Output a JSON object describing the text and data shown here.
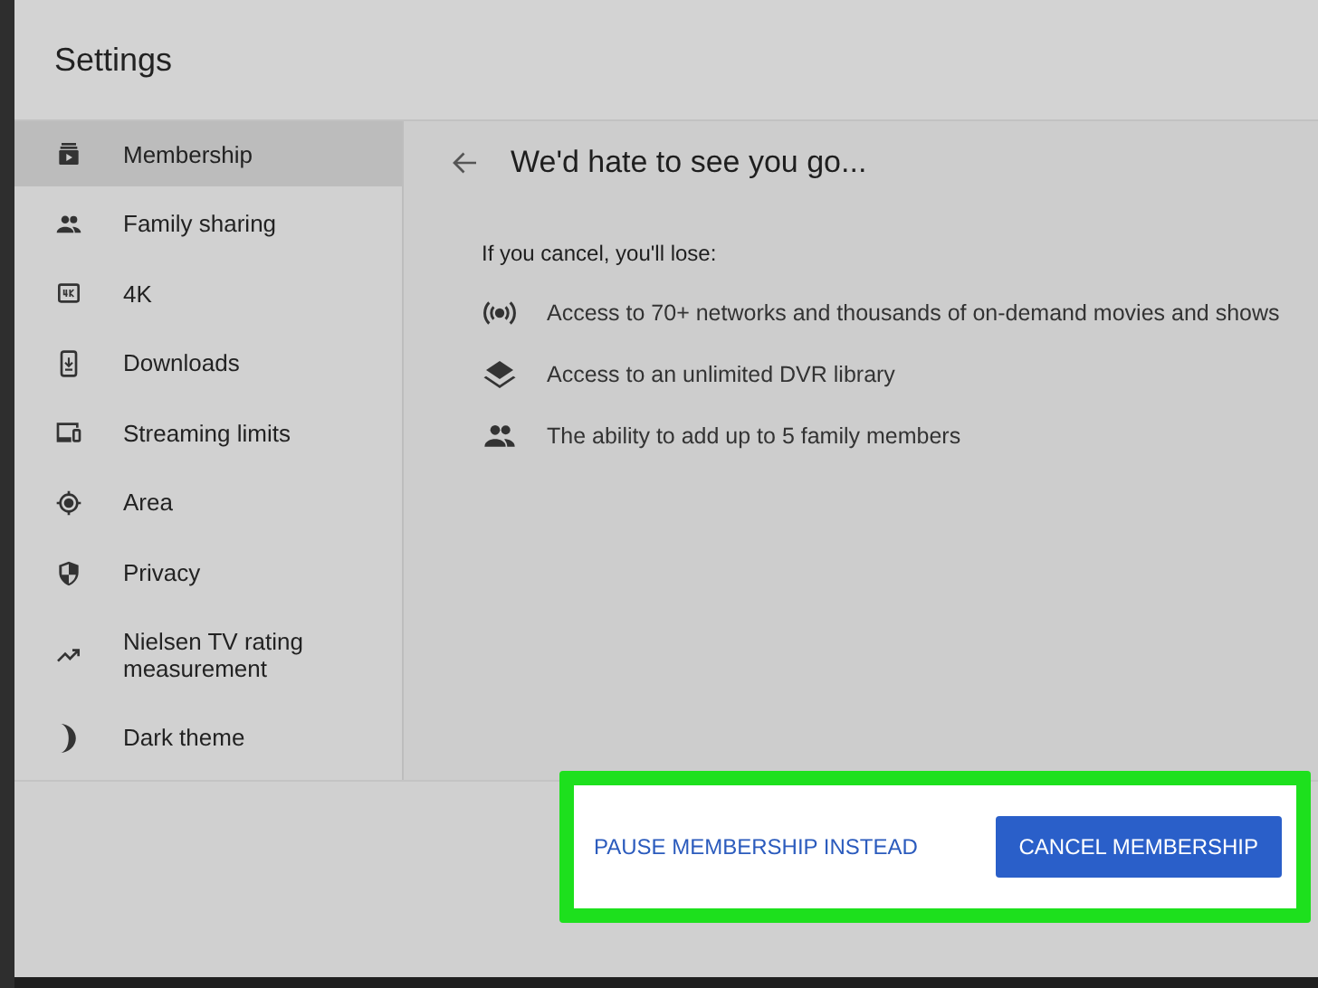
{
  "window": {
    "title": "Settings"
  },
  "sidebar": {
    "items": [
      {
        "label": "Membership",
        "selected": true
      },
      {
        "label": "Family sharing",
        "selected": false
      },
      {
        "label": "4K",
        "selected": false
      },
      {
        "label": "Downloads",
        "selected": false
      },
      {
        "label": "Streaming limits",
        "selected": false
      },
      {
        "label": "Area",
        "selected": false
      },
      {
        "label": "Privacy",
        "selected": false
      },
      {
        "label": "Nielsen TV rating measurement",
        "selected": false
      },
      {
        "label": "Dark theme",
        "selected": false
      }
    ]
  },
  "page": {
    "heading": "We'd hate to see you go...",
    "subheading": "If you cancel, you'll lose:",
    "benefits": [
      "Access to 70+ networks and thousands of on-demand movies and shows",
      "Access to an unlimited DVR library",
      "The ability to add up to 5 family members"
    ]
  },
  "footer": {
    "buttons": [
      {
        "label": "PAUSE MEMBERSHIP INSTEAD",
        "kind": "text"
      },
      {
        "label": "CANCEL MEMBERSHIP",
        "kind": "filled"
      }
    ]
  }
}
